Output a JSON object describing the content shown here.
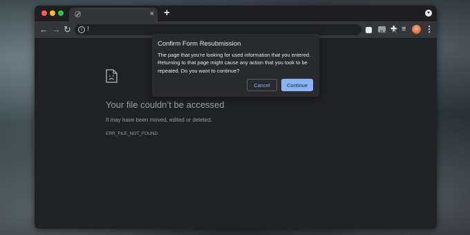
{
  "browser": {
    "tab": {
      "title": "",
      "close_glyph": "×"
    },
    "new_tab_glyph": "+",
    "toolbar": {
      "back_glyph": "←",
      "forward_glyph": "→",
      "reload_glyph": "↻",
      "url": "!",
      "star_glyph": "☆",
      "extension_badge": "Off",
      "puzzle_glyph": "✚",
      "queue_glyph": "≡",
      "menu_glyph": "⋮"
    },
    "icons": {
      "tab_favicon": "blocked-globe-icon",
      "profile": "profile-dropdown-icon",
      "site_info": "info-icon",
      "bookmark": "star-icon",
      "extension_1": "extension-icon",
      "extension_2": "extension-off-icon",
      "extensions": "puzzle-icon",
      "reading_list": "reading-list-icon",
      "avatar": "avatar",
      "menu": "kebab-menu-icon",
      "error": "sad-file-icon"
    }
  },
  "error_page": {
    "title": "Your file couldn’t be accessed",
    "description": "It may have been moved, edited or deleted.",
    "code": "ERR_FILE_NOT_FOUND"
  },
  "dialog": {
    "title": "Confirm Form Resubmission",
    "message": "The page that you're looking for used information that you entered. Returning to that page might cause any action that you took to be repeated. Do you want to continue?",
    "cancel_label": "Cancel",
    "continue_label": "Continue"
  },
  "colors": {
    "window_bg": "#202124",
    "toolbar_bg": "#35363a",
    "accent": "#8ab4f8",
    "text_muted": "#9aa0a6",
    "dialog_bg": "#292a2d"
  }
}
